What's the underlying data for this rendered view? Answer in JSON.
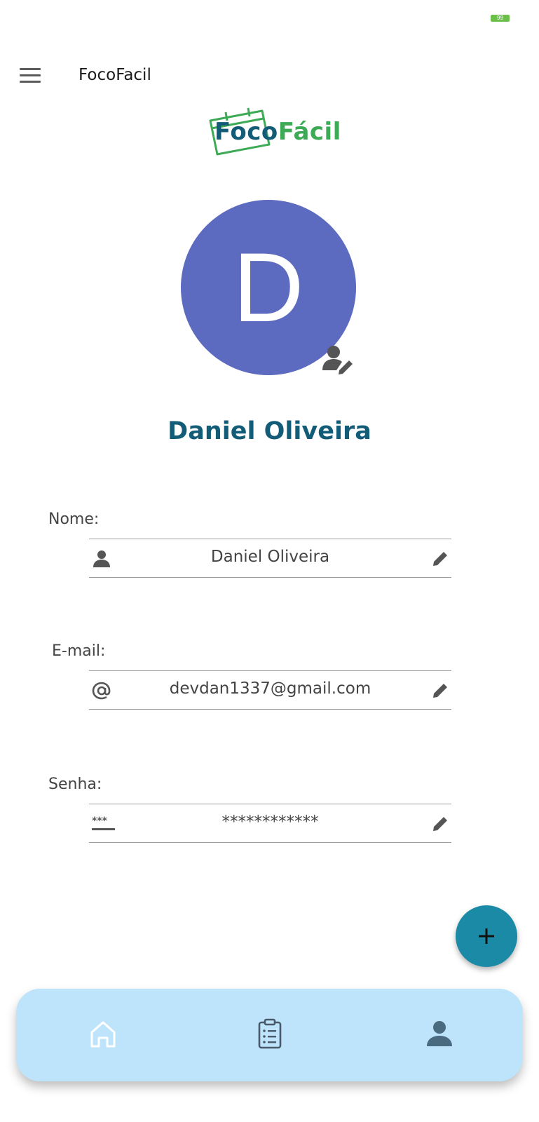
{
  "status_bar": {
    "battery": "99"
  },
  "app_bar": {
    "title": "FocoFacil",
    "menu_icon": "menu-icon"
  },
  "logo": {
    "part1": "Foco",
    "part2": "Fácil",
    "colors": {
      "part1": "#135c78",
      "part2": "#3daa55"
    }
  },
  "profile": {
    "avatar_letter": "D",
    "avatar_color": "#5c6bc0",
    "name": "Daniel Oliveira",
    "edit_icon": "person-edit-icon"
  },
  "fields": [
    {
      "label": "Nome:",
      "value": "Daniel Oliveira",
      "icon": "person-icon",
      "edit_icon": "pencil-icon"
    },
    {
      "label": "E-mail:",
      "value": "devdan1337@gmail.com",
      "icon": "at-sign-icon",
      "edit_icon": "pencil-icon"
    },
    {
      "label": "Senha:",
      "value": "************",
      "icon": "password-icon",
      "edit_icon": "pencil-icon"
    }
  ],
  "fab": {
    "icon": "plus-icon",
    "color": "#1b8aa6"
  },
  "bottom_nav": {
    "background": "#bde4fb",
    "items": [
      {
        "icon": "home-icon"
      },
      {
        "icon": "clipboard-list-icon"
      },
      {
        "icon": "person-icon"
      }
    ]
  }
}
